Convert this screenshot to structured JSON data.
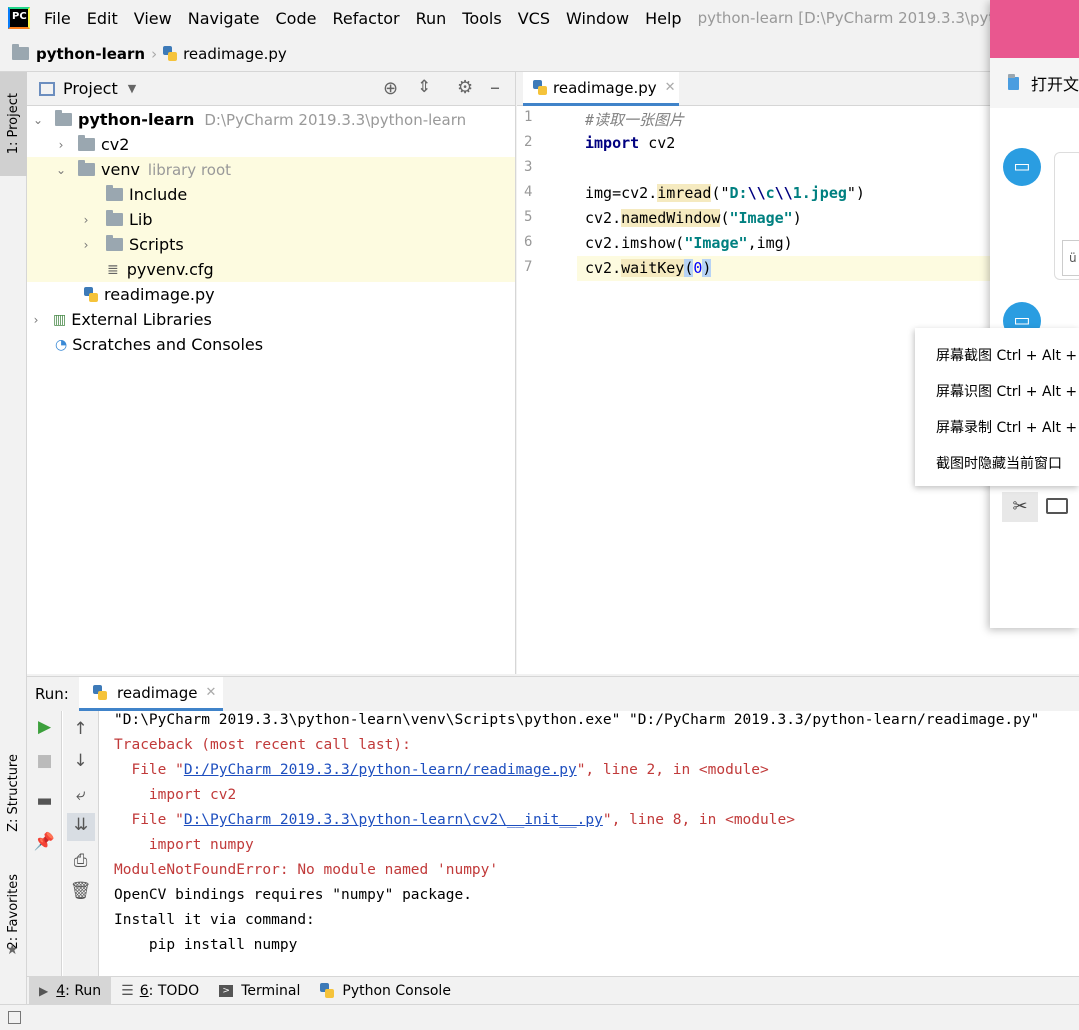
{
  "menubar": {
    "items": [
      "File",
      "Edit",
      "View",
      "Navigate",
      "Code",
      "Refactor",
      "Run",
      "Tools",
      "VCS",
      "Window",
      "Help"
    ],
    "window_title": "python-learn [D:\\PyCharm 2019.3.3\\python-le"
  },
  "breadcrumb": {
    "project": "python-learn",
    "file": "readimage.py"
  },
  "left_strip": {
    "project_tab": "1: Project",
    "structure_tab": "Z: Structure",
    "favorites_tab": "2: Favorites"
  },
  "project_panel": {
    "title": "Project",
    "tree": {
      "root_name": "python-learn",
      "root_path": "D:\\PyCharm 2019.3.3\\python-learn",
      "cv2": "cv2",
      "venv": "venv",
      "venv_hint": "library root",
      "include": "Include",
      "lib": "Lib",
      "scripts": "Scripts",
      "pyvenv": "pyvenv.cfg",
      "readimage": "readimage.py",
      "ext_libs": "External Libraries",
      "scratches": "Scratches and Consoles"
    }
  },
  "editor": {
    "tab_label": "readimage.py",
    "line_numbers": [
      "1",
      "2",
      "3",
      "4",
      "5",
      "6",
      "7"
    ],
    "code": {
      "l1": "#读取一张图片",
      "l2_kw": "import",
      "l2_rest": " cv2",
      "l4_a": "img=cv2.",
      "l4_fn": "imread",
      "l4_b": "(\"",
      "l4_s1": "D:",
      "l4_e1": "\\\\",
      "l4_s2": "c",
      "l4_e2": "\\\\",
      "l4_s3": "1.jpeg",
      "l4_c": "\")",
      "l5_a": "cv2.",
      "l5_fn": "namedWindow",
      "l5_b": "(",
      "l5_s": "\"Image\"",
      "l5_c": ")",
      "l6_a": "cv2.imshow(",
      "l6_s": "\"Image\"",
      "l6_c": ",img)",
      "l7_a": "cv2.",
      "l7_fn": "waitKey",
      "l7_p1": "(",
      "l7_n": "0",
      "l7_p2": ")"
    }
  },
  "popup": {
    "header_text": "打开文",
    "menu_items": [
      "屏幕截图 Ctrl + Alt +",
      "屏幕识图 Ctrl + Alt +",
      "屏幕录制 Ctrl + Alt +",
      "截图时隐藏当前窗口"
    ],
    "input_peek": "ü"
  },
  "run_panel": {
    "label": "Run:",
    "tab_label": "readimage",
    "output": {
      "cmd": "\"D:\\PyCharm 2019.3.3\\python-learn\\venv\\Scripts\\python.exe\" \"D:/PyCharm 2019.3.3/python-learn/readimage.py\"",
      "traceback": "Traceback (most recent call last):",
      "file1_pre": "  File \"",
      "file1_link": "D:/PyCharm 2019.3.3/python-learn/readimage.py",
      "file1_post": "\", line 2, in <module>",
      "import_cv2": "    import cv2",
      "file2_pre": "  File \"",
      "file2_link": "D:\\PyCharm 2019.3.3\\python-learn\\cv2\\__init__.py",
      "file2_post": "\", line 8, in <module>",
      "import_numpy": "    import numpy",
      "error": "ModuleNotFoundError: No module named 'numpy'",
      "opencv": "OpenCV bindings requires \"numpy\" package.",
      "install": "Install it via command:",
      "pip": "    pip install numpy"
    }
  },
  "bottom_bar": {
    "run_num": "4",
    "run_label": ": Run",
    "todo_num": "6",
    "todo_label": ": TODO",
    "terminal": "Terminal",
    "python_console": "Python Console"
  },
  "colors": {
    "accent_tab": "#4083c9",
    "highlight_row": "#fdfbe0",
    "error_text": "#c13a3a",
    "link": "#1e4fbf",
    "popup_pink": "#e9578f"
  }
}
